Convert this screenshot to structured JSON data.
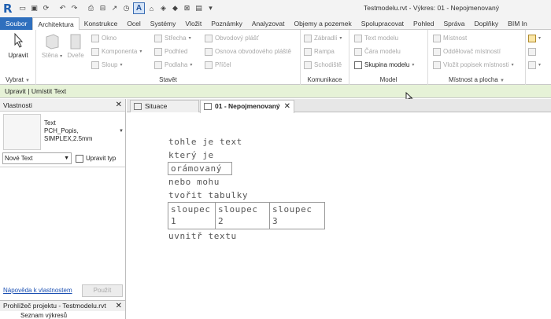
{
  "app": {
    "logo": "R",
    "window_title": "Testmodelu.rvt - Výkres: 01 - Nepojmenovaný"
  },
  "ribbon_tabs": [
    "Soubor",
    "Architektura",
    "Konstrukce",
    "Ocel",
    "Systémy",
    "Vložit",
    "Poznámky",
    "Analyzovat",
    "Objemy a pozemek",
    "Spolupracovat",
    "Pohled",
    "Správa",
    "Doplňky",
    "BIM In"
  ],
  "active_tab": "Architektura",
  "ribbon": {
    "select": {
      "button": "Upravit",
      "label": "Vybrat"
    },
    "build": {
      "label": "Stavět",
      "col1": [
        "Stěna",
        "Dveře"
      ],
      "col2": [
        "Okno",
        "Komponenta",
        "Sloup"
      ],
      "col3": [
        "Střecha",
        "Podhled",
        "Podlaha"
      ],
      "col4": [
        "Obvodový plášť",
        "Osnova obvodového pláště",
        "Příčel"
      ]
    },
    "circulation": {
      "label": "Komunikace",
      "items": [
        "Zábradlí",
        "Rampa",
        "Schodiště"
      ]
    },
    "model": {
      "label": "Model",
      "items": [
        "Text modelu",
        "Čára modelu",
        "Skupina modelu"
      ]
    },
    "room": {
      "label": "Místnost a plocha",
      "items": [
        "Místnost",
        "Oddělovač místností",
        "Vložit popisek místnosti"
      ]
    }
  },
  "options_bar": "Upravit | Umístit Text",
  "properties": {
    "title": "Vlastnosti",
    "type_lines": [
      "Text",
      "PCH_Popis,",
      "SIMPLEX,2.5mm"
    ],
    "instance_select": "Nové Text",
    "edit_type": "Upravit typ",
    "help": "Nápověda k vlastnostem",
    "apply": "Použít"
  },
  "browser": {
    "title": "Prohlížeč projektu - Testmodelu.rvt",
    "item": "Seznam výkresů"
  },
  "view_tabs": [
    {
      "label": "Situace",
      "active": false
    },
    {
      "label": "01 - Nepojmenovaný",
      "active": true
    }
  ],
  "canvas": {
    "lines": [
      "tohle je text",
      "který je",
      "orámovaný",
      "nebo mohu",
      "tvořit tabulky",
      "uvnitř textu"
    ],
    "table": {
      "headers": [
        "sloupec",
        "sloupec",
        "sloupec"
      ],
      "values": [
        "1",
        "2",
        "3"
      ]
    }
  },
  "colors": {
    "file_tab": "#2f6fbd",
    "options_bar": "#e6f2d7"
  }
}
